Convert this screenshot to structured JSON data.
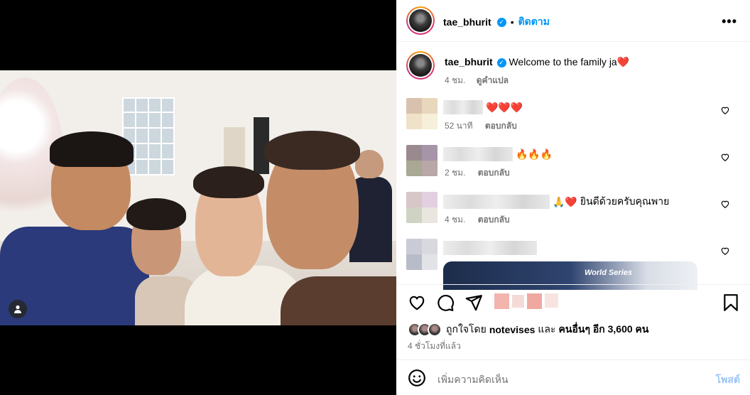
{
  "header": {
    "username": "tae_bhurit",
    "follow_label": "ติดตาม",
    "more_icon": "more-horizontal-icon"
  },
  "caption": {
    "username": "tae_bhurit",
    "text": "Welcome to the family ja",
    "emoji": "❤️",
    "time": "4 ชม.",
    "translate_label": "ดูคำแปล"
  },
  "comments": [
    {
      "emoji": "❤️❤️❤️",
      "text": "",
      "time": "52 นาที",
      "reply_label": "ตอบกลับ"
    },
    {
      "emoji": "🔥🔥🔥",
      "text": "",
      "time": "2 ชม.",
      "reply_label": "ตอบกลับ"
    },
    {
      "emoji": "🙏❤️",
      "text": "ยินดีด้วยครับคุณพาย",
      "time": "4 ชม.",
      "reply_label": "ตอบกลับ"
    },
    {
      "emoji": "",
      "text": "",
      "time": "",
      "reply_label": ""
    }
  ],
  "actions": {
    "like_icon": "heart-icon",
    "comment_icon": "comment-icon",
    "share_icon": "send-icon",
    "save_icon": "bookmark-icon"
  },
  "likes": {
    "text_prefix": "ถูกใจโดย",
    "user": "notevises",
    "text_mid": "และ",
    "others": "คนอื่นๆ อีก 3,600 คน"
  },
  "timestamp": "4 ชั่วโมงที่แล้ว",
  "add_comment": {
    "placeholder": "เพิ่มความคิดเห็น",
    "post_label": "โพสต์",
    "emoji_icon": "smiley-icon"
  },
  "colors": {
    "accent": "#0095f6",
    "secondary_text": "#737373",
    "heart": "#ed2a3b"
  }
}
